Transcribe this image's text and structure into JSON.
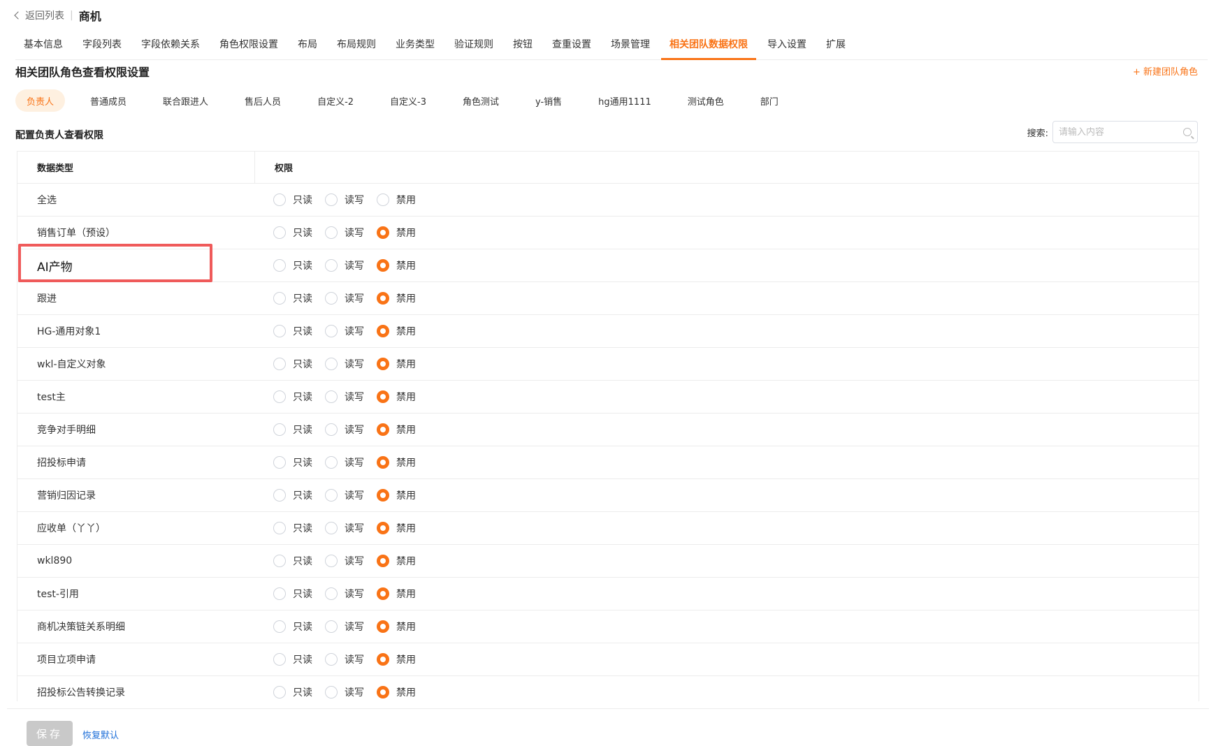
{
  "header": {
    "back_label": "返回列表",
    "title": "商机"
  },
  "main_tabs": [
    {
      "label": "基本信息"
    },
    {
      "label": "字段列表"
    },
    {
      "label": "字段依赖关系"
    },
    {
      "label": "角色权限设置"
    },
    {
      "label": "布局"
    },
    {
      "label": "布局规则"
    },
    {
      "label": "业务类型"
    },
    {
      "label": "验证规则"
    },
    {
      "label": "按钮"
    },
    {
      "label": "查重设置"
    },
    {
      "label": "场景管理"
    },
    {
      "label": "相关团队数据权限",
      "active": true
    },
    {
      "label": "导入设置"
    },
    {
      "label": "扩展"
    }
  ],
  "section": {
    "title": "相关团队角色查看权限设置",
    "new_role_label": "+ 新建团队角色"
  },
  "role_tabs": [
    {
      "label": "负责人",
      "active": true
    },
    {
      "label": "普通成员"
    },
    {
      "label": "联合跟进人"
    },
    {
      "label": "售后人员"
    },
    {
      "label": "自定义-2"
    },
    {
      "label": "自定义-3"
    },
    {
      "label": "角色测试"
    },
    {
      "label": "y-销售"
    },
    {
      "label": "hg通用1111"
    },
    {
      "label": "测试角色"
    },
    {
      "label": "部门"
    }
  ],
  "config": {
    "label": "配置负责人查看权限",
    "search_label": "搜索:",
    "search_placeholder": "请输入内容"
  },
  "table": {
    "headers": {
      "data_type": "数据类型",
      "permission": "权限"
    },
    "options": {
      "readonly": "只读",
      "readwrite": "读写",
      "disabled": "禁用"
    },
    "rows": [
      {
        "name": "全选",
        "selected": "none"
      },
      {
        "name": "销售订单（预设）",
        "selected": "disabled"
      },
      {
        "name": "AI产物",
        "selected": "disabled",
        "highlighted": true
      },
      {
        "name": "跟进",
        "selected": "disabled"
      },
      {
        "name": "HG-通用对象1",
        "selected": "disabled"
      },
      {
        "name": "wkl-自定义对象",
        "selected": "disabled"
      },
      {
        "name": "test主",
        "selected": "disabled"
      },
      {
        "name": "竞争对手明细",
        "selected": "disabled"
      },
      {
        "name": "招投标申请",
        "selected": "disabled"
      },
      {
        "name": "营销归因记录",
        "selected": "disabled"
      },
      {
        "name": "应收单（丫丫）",
        "selected": "disabled"
      },
      {
        "name": "wkl890",
        "selected": "disabled"
      },
      {
        "name": "test-引用",
        "selected": "disabled"
      },
      {
        "name": "商机决策链关系明细",
        "selected": "disabled"
      },
      {
        "name": "项目立项申请",
        "selected": "disabled"
      },
      {
        "name": "招投标公告转换记录",
        "selected": "disabled"
      }
    ]
  },
  "footer": {
    "save_label": "保存",
    "restore_label": "恢复默认"
  },
  "colors": {
    "accent": "#f97316",
    "highlight_border": "#ef5a5a",
    "link": "#1e6fd9",
    "disabled_button": "#c9c9c9"
  }
}
